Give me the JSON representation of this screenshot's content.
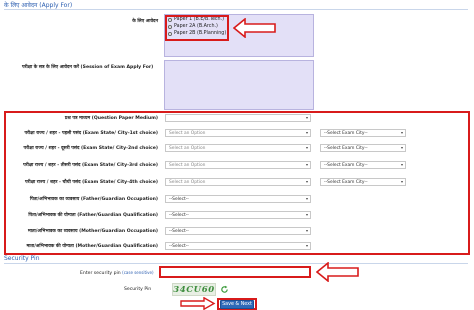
{
  "top_section": {
    "title": "के लिए आवेदन (Apply For)"
  },
  "apply_for": {
    "label": "के लिए आवेदन",
    "options": [
      "Paper 1 (B.E/B.Tech.)",
      "Paper 2A (B.Arch.)",
      "Paper 2B (B.Planning)"
    ]
  },
  "session": {
    "label": "परीक्षा के सत्र के लिए आवेदन करें (Session of Exam Apply For)"
  },
  "form_rows": [
    {
      "label": "प्रश्न पत्र माध्यम (Question Paper Medium)",
      "select1": "",
      "select2": null
    },
    {
      "label": "परीक्षा राज्य / शहर - पहली पसंद (Exam State/ City-1st choice)",
      "select1": "Select an Option",
      "select2": "--Select Exam City--"
    },
    {
      "label": "परीक्षा राज्य / शहर - दूसरी पसंद (Exam State/ City-2nd choice)",
      "select1": "Select an Option",
      "select2": "--Select Exam City--"
    },
    {
      "label": "परीक्षा राज्य / शहर - तीसरी पसंद (Exam State/ City-3rd choice)",
      "select1": "Select an Option",
      "select2": "--Select Exam City--"
    },
    {
      "label": "परीक्षा राज्य / शहर - चौथी पसंद (Exam State/ City-4th choice)",
      "select1": "Select an Option",
      "select2": "--Select Exam City--"
    },
    {
      "label": "पिता/अभिभावक का व्यवसाय (Father/Guardian Occupation)",
      "select1": "--Select--",
      "select2": null
    },
    {
      "label": "पिता/अभिभावक की योग्यता (Father/Guardian Qualification)",
      "select1": "--Select--",
      "select2": null
    },
    {
      "label": "माता/अभिभावक का व्यवसाय (Mother/Guardian Occupation)",
      "select1": "--Select--",
      "select2": null
    },
    {
      "label": "माता/अभिभावक की योग्यता (Mother/Guardian Qualification)",
      "select1": "--Select--",
      "select2": null
    }
  ],
  "security": {
    "title": "Security Pin",
    "enter_label": "Enter security pin",
    "enter_hint": "(case sensitive)",
    "pin_label": "Security Pin",
    "captcha_text": "34CU60"
  },
  "submit": {
    "label": "Save & Next"
  },
  "colors": {
    "accent": "#2e69b8",
    "highlight": "#d81b1b",
    "panel": "#e3e0f7"
  },
  "icons": {
    "refresh": "refresh-icon",
    "arrows": "left-arrow-icon"
  }
}
